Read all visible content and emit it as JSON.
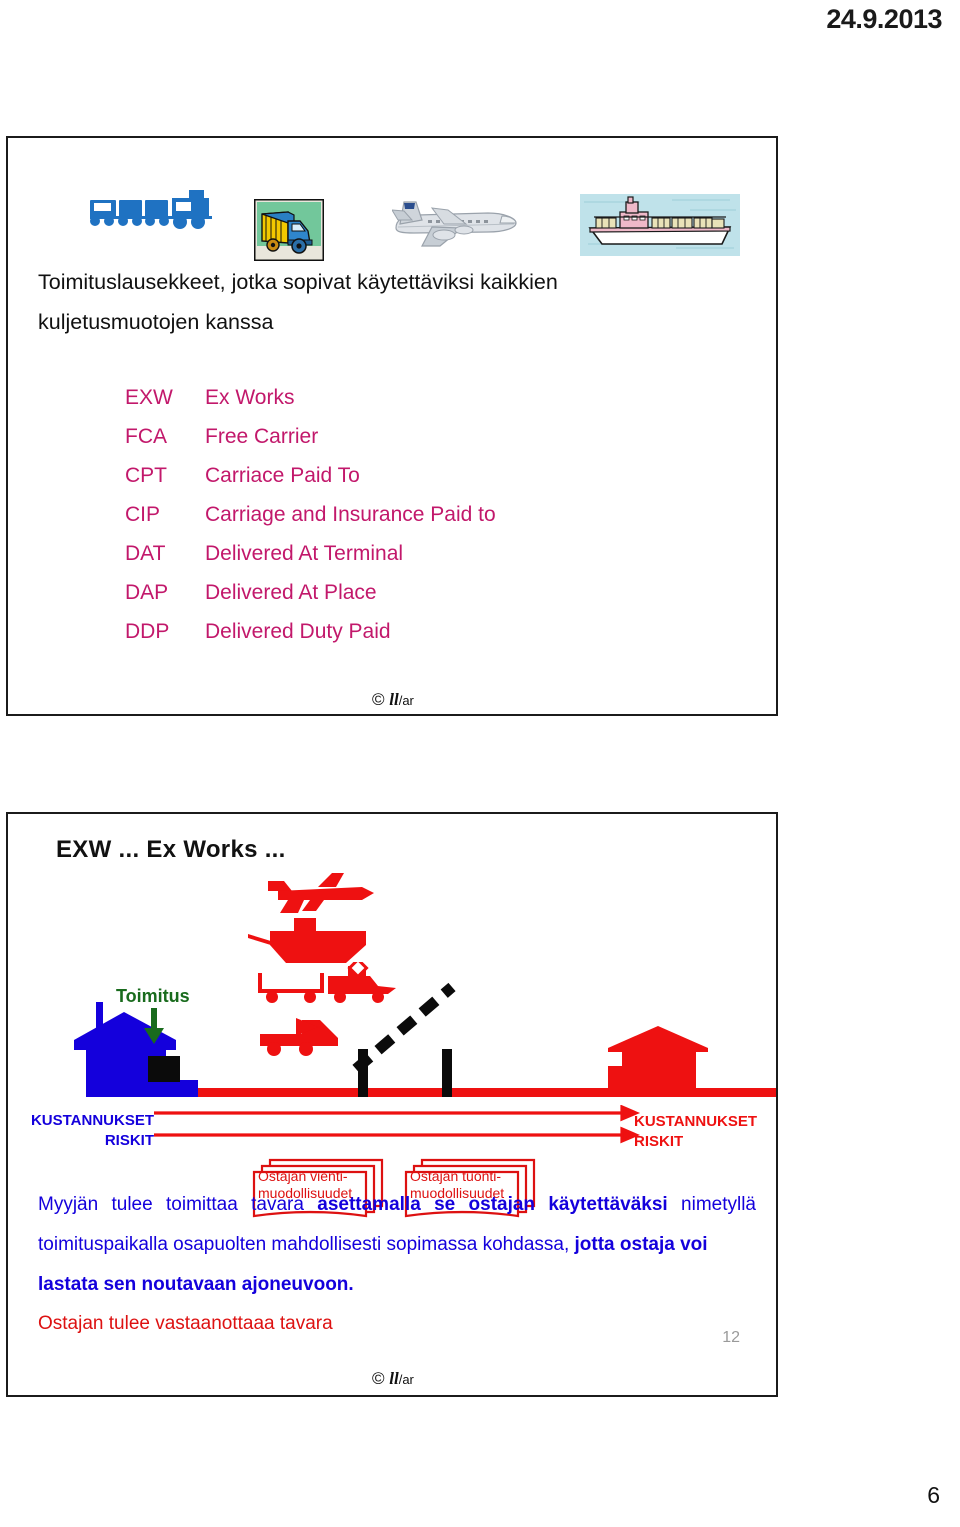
{
  "document": {
    "date": "24.9.2013",
    "page_number": "6"
  },
  "slide1": {
    "transport_icons": [
      {
        "name": "train-icon",
        "label": "train"
      },
      {
        "name": "truck-icon",
        "label": "truck"
      },
      {
        "name": "airplane-icon",
        "label": "airplane"
      },
      {
        "name": "ship-icon",
        "label": "cargo ship"
      }
    ],
    "title_line1": "Toimituslausekkeet, jotka sopivat käytettäviksi kaikkien",
    "title_line2": "kuljetusmuotojen kanssa",
    "terms": [
      {
        "code": "EXW",
        "name": "Ex Works"
      },
      {
        "code": "FCA",
        "name": "Free Carrier"
      },
      {
        "code": "CPT",
        "name": "Carriace Paid To"
      },
      {
        "code": "CIP",
        "name": "Carriage and Insurance Paid to"
      },
      {
        "code": "DAT",
        "name": "Delivered At Terminal"
      },
      {
        "code": "DAP",
        "name": "Delivered At Place"
      },
      {
        "code": "DDP",
        "name": "Delivered Duty Paid"
      }
    ],
    "copyright": {
      "mark": "©",
      "brand": "ll",
      "suffix": "/ar"
    },
    "colors": {
      "terms": "#c2186b",
      "text": "#111111"
    }
  },
  "slide2": {
    "heading": "EXW ...   Ex Works ...",
    "diagram": {
      "delivery_label": "Toimitus",
      "left_labels": [
        "KUSTANNUKSET",
        "RISKIT"
      ],
      "right_labels": [
        "KUSTANNUKSET",
        "RISKIT"
      ],
      "doc_box_1_line1": "Ostajan vienti-",
      "doc_box_1_line2": "muodollisuudet",
      "doc_box_2_line1": "Ostajan tuonti-",
      "doc_box_2_line2": "muodollisuudet",
      "colors": {
        "seller_building": "#1400dc",
        "buyer_building": "#ee1111",
        "delivery_label": "#196b1d",
        "cost_risk_left": "#1400dc",
        "cost_risk_right": "#ee1111"
      }
    },
    "body": {
      "seg1": "Myyjän tulee toimittaa tavara ",
      "seg2_bold": "asettamalla se ostajan käytettäväksi",
      "seg3": " nimetyllä toimituspaikalla osapuolten mahdollisesti sopimassa  kohdassa, ",
      "seg4_bold": "jotta ostaja voi",
      "seg5_bold": "lastata sen noutavaan ajoneuvoon.",
      "last_line": "Ostajan tulee vastaanottaaa tavara"
    },
    "copyright": {
      "mark": "©",
      "brand": "ll",
      "suffix": "/ar"
    },
    "page_number": "12"
  }
}
